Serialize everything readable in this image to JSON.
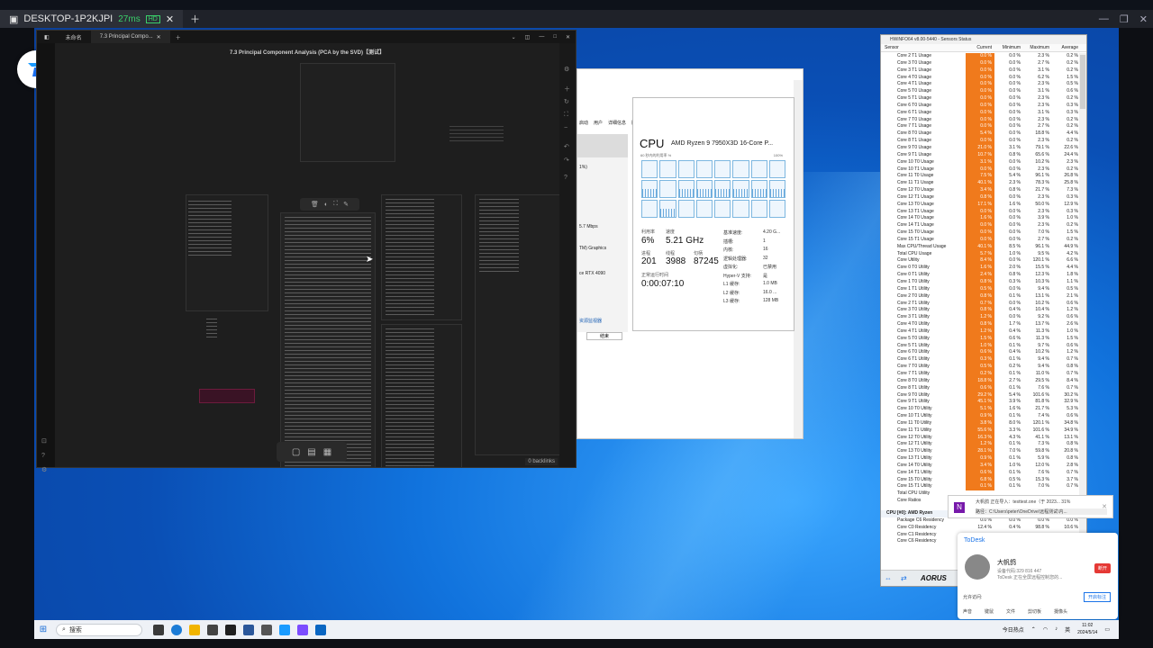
{
  "host": {
    "device": "DESKTOP-1P2KJPI",
    "ping": "27ms",
    "hd": "HD"
  },
  "notes": {
    "tabs": [
      "未命名",
      "7.3 Principal Compo..."
    ],
    "doc_title": "7.3 Principal Component Analysis (PCA by the SVD)【测试】",
    "backlinks": "0 backlinks"
  },
  "taskmgr": {
    "tabs": [
      "启动",
      "用户",
      "详细信息",
      "服务"
    ],
    "left_items": [
      "1%)",
      "5.7 Mbps",
      "TM) Graphics",
      "ce RTX 4090"
    ],
    "link": "资源监视器",
    "button": "结束",
    "title": "CPU",
    "model": "AMD Ryzen 9 7950X3D 16-Core P...",
    "graph_caption": "60 秒内的利用率 %",
    "graph_max": "100%",
    "usage_label": "利用率",
    "usage_value": "6%",
    "speed_label": "速度",
    "speed_value": "5.21 GHz",
    "proc_label": "进程",
    "proc_value": "201",
    "thread_label": "线程",
    "thread_value": "3988",
    "handle_label": "句柄",
    "handle_value": "87245",
    "uptime_label": "正常运行时间",
    "uptime_value": "0:00:07:10",
    "specs": [
      {
        "k": "基准速度:",
        "v": "4.20 G..."
      },
      {
        "k": "插槽:",
        "v": "1"
      },
      {
        "k": "内核:",
        "v": "16"
      },
      {
        "k": "逻辑处理器:",
        "v": "32"
      },
      {
        "k": "虚拟化:",
        "v": "已禁用"
      },
      {
        "k": "Hyper-V 支持:",
        "v": "是"
      },
      {
        "k": "L1 缓存:",
        "v": "1.0 MB"
      },
      {
        "k": "L2 缓存:",
        "v": "16.0 ..."
      },
      {
        "k": "L3 缓存:",
        "v": "128 MB"
      }
    ]
  },
  "hwinfo": {
    "title": "HWiNFO64 v8.00-5440 - Sensors Status",
    "headers": [
      "Sensor",
      "Current",
      "Minimum",
      "Maximum",
      "Average"
    ],
    "rows": [
      [
        "Core 2 T1 Usage",
        "0.0 %",
        "0.0 %",
        "2.3 %",
        "0.2 %"
      ],
      [
        "Core 3 T0 Usage",
        "0.0 %",
        "0.0 %",
        "2.7 %",
        "0.2 %"
      ],
      [
        "Core 3 T1 Usage",
        "0.0 %",
        "0.0 %",
        "3.1 %",
        "0.2 %"
      ],
      [
        "Core 4 T0 Usage",
        "0.0 %",
        "0.0 %",
        "6.2 %",
        "1.5 %"
      ],
      [
        "Core 4 T1 Usage",
        "0.0 %",
        "0.0 %",
        "2.3 %",
        "0.5 %"
      ],
      [
        "Core 5 T0 Usage",
        "0.0 %",
        "0.0 %",
        "3.1 %",
        "0.6 %"
      ],
      [
        "Core 5 T1 Usage",
        "0.0 %",
        "0.0 %",
        "2.3 %",
        "0.2 %"
      ],
      [
        "Core 6 T0 Usage",
        "0.0 %",
        "0.0 %",
        "2.3 %",
        "0.3 %"
      ],
      [
        "Core 6 T1 Usage",
        "0.0 %",
        "0.0 %",
        "3.1 %",
        "0.3 %"
      ],
      [
        "Core 7 T0 Usage",
        "0.0 %",
        "0.0 %",
        "2.3 %",
        "0.2 %"
      ],
      [
        "Core 7 T1 Usage",
        "0.0 %",
        "0.0 %",
        "2.7 %",
        "0.2 %"
      ],
      [
        "Core 8 T0 Usage",
        "5.4 %",
        "0.0 %",
        "18.8 %",
        "4.4 %"
      ],
      [
        "Core 8 T1 Usage",
        "0.0 %",
        "0.0 %",
        "2.3 %",
        "0.2 %"
      ],
      [
        "Core 9 T0 Usage",
        "21.0 %",
        "3.1 %",
        "79.1 %",
        "22.6 %"
      ],
      [
        "Core 9 T1 Usage",
        "10.7 %",
        "0.8 %",
        "65.6 %",
        "24.4 %"
      ],
      [
        "Core 10 T0 Usage",
        "3.1 %",
        "0.0 %",
        "10.2 %",
        "2.3 %"
      ],
      [
        "Core 10 T1 Usage",
        "0.0 %",
        "0.0 %",
        "2.3 %",
        "0.2 %"
      ],
      [
        "Core 11 T0 Usage",
        "7.5 %",
        "5.4 %",
        "96.1 %",
        "26.8 %"
      ],
      [
        "Core 11 T1 Usage",
        "40.1 %",
        "2.3 %",
        "78.3 %",
        "25.8 %"
      ],
      [
        "Core 12 T0 Usage",
        "3.4 %",
        "0.8 %",
        "21.7 %",
        "7.3 %"
      ],
      [
        "Core 12 T1 Usage",
        "0.8 %",
        "0.0 %",
        "2.3 %",
        "0.3 %"
      ],
      [
        "Core 13 T0 Usage",
        "17.1 %",
        "1.6 %",
        "50.0 %",
        "12.9 %"
      ],
      [
        "Core 13 T1 Usage",
        "0.0 %",
        "0.0 %",
        "2.3 %",
        "0.3 %"
      ],
      [
        "Core 14 T0 Usage",
        "1.6 %",
        "0.0 %",
        "3.9 %",
        "1.0 %"
      ],
      [
        "Core 14 T1 Usage",
        "0.0 %",
        "0.0 %",
        "2.3 %",
        "0.2 %"
      ],
      [
        "Core 15 T0 Usage",
        "0.0 %",
        "0.0 %",
        "7.0 %",
        "1.5 %"
      ],
      [
        "Core 15 T1 Usage",
        "0.0 %",
        "0.0 %",
        "2.7 %",
        "0.2 %"
      ],
      [
        "Max CPU/Thread Usage",
        "40.1 %",
        "8.5 %",
        "96.1 %",
        "44.9 %"
      ],
      [
        "Total CPU Usage",
        "5.7 %",
        "1.0 %",
        "9.5 %",
        "4.2 %"
      ],
      [
        "Core Utility",
        "8.4 %",
        "0.0 %",
        "120.1 %",
        "6.6 %"
      ],
      [
        "Core 0 T0 Utility",
        "1.6 %",
        "2.0 %",
        "15.5 %",
        "4.4 %"
      ],
      [
        "Core 0 T1 Utility",
        "2.4 %",
        "0.8 %",
        "12.3 %",
        "1.8 %"
      ],
      [
        "Core 1 T0 Utility",
        "0.8 %",
        "0.3 %",
        "10.3 %",
        "1.1 %"
      ],
      [
        "Core 1 T1 Utility",
        "0.5 %",
        "0.0 %",
        "9.4 %",
        "0.5 %"
      ],
      [
        "Core 2 T0 Utility",
        "0.8 %",
        "0.1 %",
        "13.1 %",
        "2.1 %"
      ],
      [
        "Core 2 T1 Utility",
        "0.7 %",
        "0.0 %",
        "10.2 %",
        "0.6 %"
      ],
      [
        "Core 3 T0 Utility",
        "0.8 %",
        "0.4 %",
        "10.4 %",
        "1.2 %"
      ],
      [
        "Core 3 T1 Utility",
        "1.2 %",
        "0.0 %",
        "9.2 %",
        "0.6 %"
      ],
      [
        "Core 4 T0 Utility",
        "0.8 %",
        "1.7 %",
        "13.7 %",
        "2.6 %"
      ],
      [
        "Core 4 T1 Utility",
        "1.2 %",
        "0.4 %",
        "11.3 %",
        "1.0 %"
      ],
      [
        "Core 5 T0 Utility",
        "1.5 %",
        "0.6 %",
        "11.3 %",
        "1.5 %"
      ],
      [
        "Core 5 T1 Utility",
        "1.0 %",
        "0.1 %",
        "9.7 %",
        "0.6 %"
      ],
      [
        "Core 6 T0 Utility",
        "0.6 %",
        "0.4 %",
        "10.2 %",
        "1.2 %"
      ],
      [
        "Core 6 T1 Utility",
        "0.3 %",
        "0.1 %",
        "9.4 %",
        "0.7 %"
      ],
      [
        "Core 7 T0 Utility",
        "0.5 %",
        "0.2 %",
        "9.4 %",
        "0.8 %"
      ],
      [
        "Core 7 T1 Utility",
        "0.2 %",
        "0.1 %",
        "11.0 %",
        "0.7 %"
      ],
      [
        "Core 8 T0 Utility",
        "18.8 %",
        "2.7 %",
        "29.5 %",
        "8.4 %"
      ],
      [
        "Core 8 T1 Utility",
        "0.6 %",
        "0.1 %",
        "7.6 %",
        "0.7 %"
      ],
      [
        "Core 9 T0 Utility",
        "29.2 %",
        "5.4 %",
        "101.6 %",
        "30.2 %"
      ],
      [
        "Core 9 T1 Utility",
        "45.1 %",
        "3.9 %",
        "81.8 %",
        "32.9 %"
      ],
      [
        "Core 10 T0 Utility",
        "5.1 %",
        "1.6 %",
        "21.7 %",
        "5.3 %"
      ],
      [
        "Core 10 T1 Utility",
        "0.9 %",
        "0.1 %",
        "7.4 %",
        "0.6 %"
      ],
      [
        "Core 11 T0 Utility",
        "3.8 %",
        "8.0 %",
        "120.1 %",
        "34.8 %"
      ],
      [
        "Core 11 T1 Utility",
        "55.6 %",
        "3.3 %",
        "101.6 %",
        "34.9 %"
      ],
      [
        "Core 12 T0 Utility",
        "16.3 %",
        "4.3 %",
        "41.1 %",
        "13.1 %"
      ],
      [
        "Core 12 T1 Utility",
        "1.2 %",
        "0.1 %",
        "7.3 %",
        "0.8 %"
      ],
      [
        "Core 13 T0 Utility",
        "28.1 %",
        "7.0 %",
        "59.8 %",
        "20.8 %"
      ],
      [
        "Core 13 T1 Utility",
        "0.9 %",
        "0.1 %",
        "5.9 %",
        "0.8 %"
      ],
      [
        "Core 14 T0 Utility",
        "3.4 %",
        "1.0 %",
        "12.0 %",
        "2.8 %"
      ],
      [
        "Core 14 T1 Utility",
        "0.6 %",
        "0.1 %",
        "7.6 %",
        "0.7 %"
      ],
      [
        "Core 15 T0 Utility",
        "6.8 %",
        "0.5 %",
        "15.3 %",
        "3.7 %"
      ],
      [
        "Core 15 T1 Utility",
        "0.1 %",
        "0.1 %",
        "7.0 %",
        "0.7 %"
      ],
      [
        "Total CPU Utility",
        "",
        "",
        "",
        ""
      ],
      [
        "Core Ratios",
        "",
        "",
        "",
        ""
      ]
    ],
    "group_title": "CPU [#0]: AMD Ryzen",
    "group_rows": [
      [
        "Package C6 Residency",
        "0.0 %",
        "0.0 %",
        "0.0 %",
        "0.0 %"
      ],
      [
        "Core C0 Residency",
        "12.4 %",
        "0.4 %",
        "98.8 %",
        "10.6 %"
      ],
      [
        "Core C1 Residency",
        "",
        "",
        "",
        ""
      ],
      [
        "Core C6 Residency",
        "",
        "",
        "",
        ""
      ]
    ],
    "brand": "AORUS"
  },
  "notification": {
    "line1": "大帆鸽 正在导入：testtest.one（于 2023... 31%",
    "line2": "路径：C:\\Users\\peter\\OneDrive\\远程测试\\内..."
  },
  "todesk": {
    "brand": "ToDesk",
    "name": "大帆鸽",
    "device_id": "设备代码:329 816 447",
    "note": "ToDesk 正在全屏远程控制您的...",
    "disconnect": "断开",
    "allow": "允许访问:",
    "open": "开启标注",
    "options": [
      "声音",
      "键鼠",
      "文件",
      "剪切板",
      "摄像头"
    ]
  },
  "taskbar": {
    "search": "搜索",
    "weather": "今日热点",
    "ime": "英",
    "time": "11:02",
    "date": "2024/5/14"
  }
}
